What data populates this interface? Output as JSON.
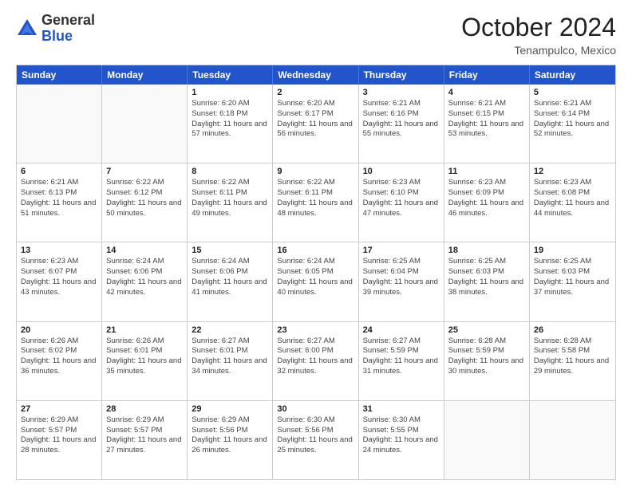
{
  "header": {
    "logo_general": "General",
    "logo_blue": "Blue",
    "month_title": "October 2024",
    "location": "Tenampulco, Mexico"
  },
  "calendar": {
    "days_of_week": [
      "Sunday",
      "Monday",
      "Tuesday",
      "Wednesday",
      "Thursday",
      "Friday",
      "Saturday"
    ],
    "weeks": [
      [
        {
          "day": "",
          "empty": true
        },
        {
          "day": "",
          "empty": true
        },
        {
          "day": "1",
          "sunrise": "6:20 AM",
          "sunset": "6:18 PM",
          "daylight": "11 hours and 57 minutes."
        },
        {
          "day": "2",
          "sunrise": "6:20 AM",
          "sunset": "6:17 PM",
          "daylight": "11 hours and 56 minutes."
        },
        {
          "day": "3",
          "sunrise": "6:21 AM",
          "sunset": "6:16 PM",
          "daylight": "11 hours and 55 minutes."
        },
        {
          "day": "4",
          "sunrise": "6:21 AM",
          "sunset": "6:15 PM",
          "daylight": "11 hours and 53 minutes."
        },
        {
          "day": "5",
          "sunrise": "6:21 AM",
          "sunset": "6:14 PM",
          "daylight": "11 hours and 52 minutes."
        }
      ],
      [
        {
          "day": "6",
          "sunrise": "6:21 AM",
          "sunset": "6:13 PM",
          "daylight": "11 hours and 51 minutes."
        },
        {
          "day": "7",
          "sunrise": "6:22 AM",
          "sunset": "6:12 PM",
          "daylight": "11 hours and 50 minutes."
        },
        {
          "day": "8",
          "sunrise": "6:22 AM",
          "sunset": "6:11 PM",
          "daylight": "11 hours and 49 minutes."
        },
        {
          "day": "9",
          "sunrise": "6:22 AM",
          "sunset": "6:11 PM",
          "daylight": "11 hours and 48 minutes."
        },
        {
          "day": "10",
          "sunrise": "6:23 AM",
          "sunset": "6:10 PM",
          "daylight": "11 hours and 47 minutes."
        },
        {
          "day": "11",
          "sunrise": "6:23 AM",
          "sunset": "6:09 PM",
          "daylight": "11 hours and 46 minutes."
        },
        {
          "day": "12",
          "sunrise": "6:23 AM",
          "sunset": "6:08 PM",
          "daylight": "11 hours and 44 minutes."
        }
      ],
      [
        {
          "day": "13",
          "sunrise": "6:23 AM",
          "sunset": "6:07 PM",
          "daylight": "11 hours and 43 minutes."
        },
        {
          "day": "14",
          "sunrise": "6:24 AM",
          "sunset": "6:06 PM",
          "daylight": "11 hours and 42 minutes."
        },
        {
          "day": "15",
          "sunrise": "6:24 AM",
          "sunset": "6:06 PM",
          "daylight": "11 hours and 41 minutes."
        },
        {
          "day": "16",
          "sunrise": "6:24 AM",
          "sunset": "6:05 PM",
          "daylight": "11 hours and 40 minutes."
        },
        {
          "day": "17",
          "sunrise": "6:25 AM",
          "sunset": "6:04 PM",
          "daylight": "11 hours and 39 minutes."
        },
        {
          "day": "18",
          "sunrise": "6:25 AM",
          "sunset": "6:03 PM",
          "daylight": "11 hours and 38 minutes."
        },
        {
          "day": "19",
          "sunrise": "6:25 AM",
          "sunset": "6:03 PM",
          "daylight": "11 hours and 37 minutes."
        }
      ],
      [
        {
          "day": "20",
          "sunrise": "6:26 AM",
          "sunset": "6:02 PM",
          "daylight": "11 hours and 36 minutes."
        },
        {
          "day": "21",
          "sunrise": "6:26 AM",
          "sunset": "6:01 PM",
          "daylight": "11 hours and 35 minutes."
        },
        {
          "day": "22",
          "sunrise": "6:27 AM",
          "sunset": "6:01 PM",
          "daylight": "11 hours and 34 minutes."
        },
        {
          "day": "23",
          "sunrise": "6:27 AM",
          "sunset": "6:00 PM",
          "daylight": "11 hours and 32 minutes."
        },
        {
          "day": "24",
          "sunrise": "6:27 AM",
          "sunset": "5:59 PM",
          "daylight": "11 hours and 31 minutes."
        },
        {
          "day": "25",
          "sunrise": "6:28 AM",
          "sunset": "5:59 PM",
          "daylight": "11 hours and 30 minutes."
        },
        {
          "day": "26",
          "sunrise": "6:28 AM",
          "sunset": "5:58 PM",
          "daylight": "11 hours and 29 minutes."
        }
      ],
      [
        {
          "day": "27",
          "sunrise": "6:29 AM",
          "sunset": "5:57 PM",
          "daylight": "11 hours and 28 minutes."
        },
        {
          "day": "28",
          "sunrise": "6:29 AM",
          "sunset": "5:57 PM",
          "daylight": "11 hours and 27 minutes."
        },
        {
          "day": "29",
          "sunrise": "6:29 AM",
          "sunset": "5:56 PM",
          "daylight": "11 hours and 26 minutes."
        },
        {
          "day": "30",
          "sunrise": "6:30 AM",
          "sunset": "5:56 PM",
          "daylight": "11 hours and 25 minutes."
        },
        {
          "day": "31",
          "sunrise": "6:30 AM",
          "sunset": "5:55 PM",
          "daylight": "11 hours and 24 minutes."
        },
        {
          "day": "",
          "empty": true
        },
        {
          "day": "",
          "empty": true
        }
      ]
    ]
  }
}
